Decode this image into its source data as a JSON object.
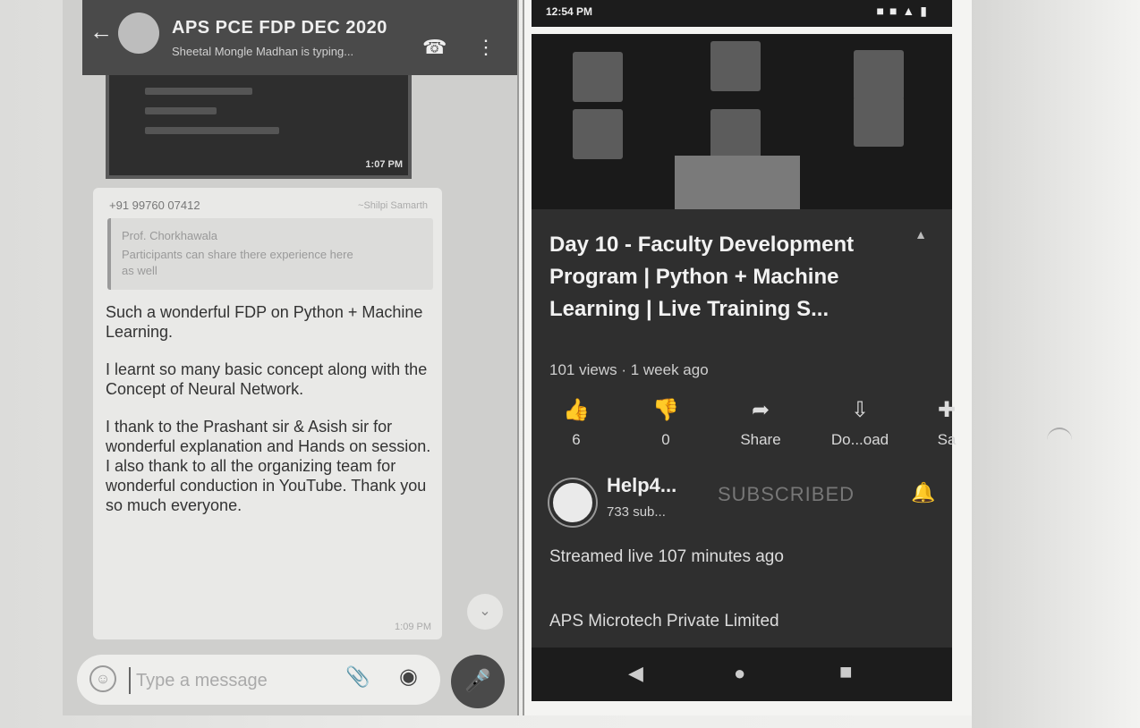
{
  "whatsapp": {
    "title": "APS PCE FDP DEC 2020",
    "subtitle": "Sheetal Mongle Madhan is typing...",
    "media_time": "1:07 PM",
    "message": {
      "sender": "+91 99760 07412",
      "sender_tag": "~Shilpi Samarth",
      "quote_name": "Prof. Chorkhawala",
      "quote_text": "Participants can share there experience here as well",
      "paragraphs": [
        "Such a wonderful FDP on Python + Machine Learning.",
        "I learnt so many basic concept along with the Concept of Neural Network.",
        "I thank to the Prashant sir & Asish sir for wonderful explanation and Hands on session.  I also thank to all the organizing team for wonderful conduction in YouTube. Thank you so much everyone."
      ],
      "time": "1:09 PM"
    },
    "composer_placeholder": "Type a message"
  },
  "youtube": {
    "status_time": "12:54 PM",
    "video_title": "Day 10 - Faculty Development Program | Python + Machine Learning | Live Training S...",
    "meta": "101 views · 1 week ago",
    "actions": [
      {
        "icon": "thumbs-up-icon",
        "label": "6"
      },
      {
        "icon": "thumbs-down-icon",
        "label": "0"
      },
      {
        "icon": "share-icon",
        "label": "Share"
      },
      {
        "icon": "download-icon",
        "label": "Do...oad"
      },
      {
        "icon": "save-icon",
        "label": "Sa"
      }
    ],
    "channel_name": "Help4...",
    "channel_subs": "733 sub...",
    "subscribe_label": "SUBSCRIBED",
    "streamed": "Streamed live 107 minutes ago",
    "company": "APS Microtech Private Limited"
  }
}
